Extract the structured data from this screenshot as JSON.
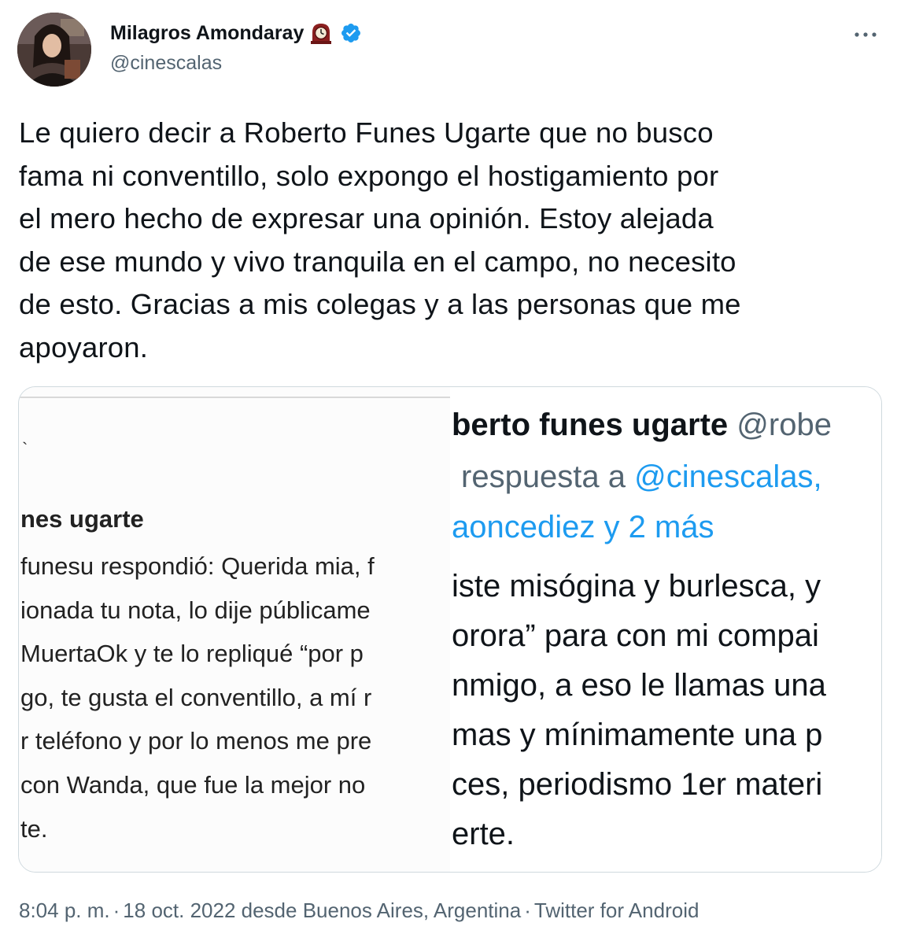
{
  "author": {
    "name": "Milagros Amondaray",
    "handle": "@cinescalas",
    "verified": true,
    "name_emoji": "clock-icon"
  },
  "tweet": {
    "lines": [
      "Le quiero decir a Roberto Funes Ugarte que no busco",
      "fama ni conventillo, solo expongo el hostigamiento por",
      "el mero hecho de expresar una opinión. Estoy alejada",
      "de ese mundo y vivo tranquila en el campo, no necesito",
      "de esto. Gracias a mis colegas y a las personas que me",
      "apoyaron."
    ]
  },
  "media": {
    "left": {
      "tick": "`",
      "title": "nes ugarte",
      "lines": [
        "funesu respondió: Querida mia, f",
        "ionada tu nota, lo dije públicame",
        "MuertaOk y te lo repliqué “por p",
        "go, te gusta el conventillo, a mí r",
        "r teléfono y por lo menos me pre",
        "con Wanda, que fue la mejor no",
        "te."
      ]
    },
    "right": {
      "name": "berto funes ugarte",
      "handle": "@robe",
      "reply_prefix": "respuesta a",
      "reply_mention": "@cinescalas,",
      "reply_more": "aoncediez y 2 más",
      "lines": [
        "iste misógina y burlesca, y",
        "orora” para con mi compai",
        "nmigo, a eso le llamas una",
        "mas y mínimamente una p",
        "ces, periodismo 1er materi",
        "erte."
      ]
    }
  },
  "meta": {
    "time": "8:04 p. m.",
    "date": "18 oct. 2022 desde Buenos Aires, Argentina",
    "source": "Twitter for Android",
    "separator": "·"
  },
  "colors": {
    "text": "#0f1419",
    "secondary": "#536471",
    "accent": "#1d9bf0",
    "border": "#cfd9de"
  }
}
